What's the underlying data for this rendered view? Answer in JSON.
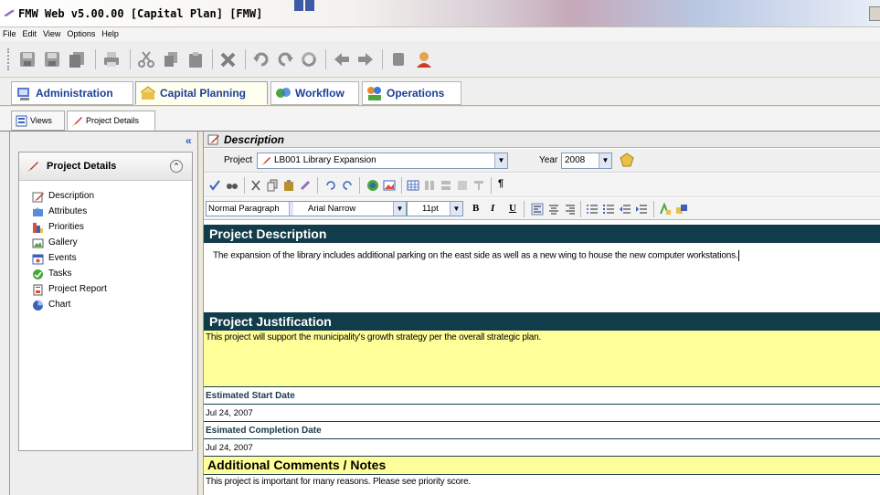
{
  "window": {
    "title": "FMW Web v5.00.00 [Capital Plan] [FMW]"
  },
  "menu": [
    "File",
    "Edit",
    "View",
    "Options",
    "Help"
  ],
  "module_tabs": [
    {
      "label": "Administration",
      "icon": "admin-icon"
    },
    {
      "label": "Capital Planning",
      "icon": "capital-planning-icon",
      "active": true
    },
    {
      "label": "Workflow",
      "icon": "workflow-icon"
    },
    {
      "label": "Operations",
      "icon": "operations-icon"
    }
  ],
  "sub_tabs": [
    {
      "label": "Views",
      "icon": "views-icon"
    },
    {
      "label": "Project Details",
      "icon": "project-details-icon",
      "active": true
    }
  ],
  "left_panel": {
    "title": "Project Details",
    "items": [
      {
        "label": "Description",
        "icon": "pencil-icon"
      },
      {
        "label": "Attributes",
        "icon": "attributes-icon"
      },
      {
        "label": "Priorities",
        "icon": "priorities-icon"
      },
      {
        "label": "Gallery",
        "icon": "gallery-icon"
      },
      {
        "label": "Events",
        "icon": "events-icon"
      },
      {
        "label": "Tasks",
        "icon": "tasks-icon"
      },
      {
        "label": "Project Report",
        "icon": "report-icon"
      },
      {
        "label": "Chart",
        "icon": "chart-icon"
      }
    ]
  },
  "main": {
    "header": "Description",
    "project_label": "Project",
    "project_value": "LB001  Library Expansion",
    "year_label": "Year",
    "year_value": "2008",
    "editor": {
      "paragraph_style": "Normal Paragraph",
      "font": "Arial Narrow",
      "size": "11pt",
      "bold": "B",
      "italic": "I",
      "underline": "U",
      "paragraph_mark": "¶"
    },
    "document": {
      "desc_heading": "Project Description",
      "desc_text": "The expansion of the library includes additional parking on the east side as well as a new wing to house the new computer workstations.",
      "just_heading": "Project Justification",
      "just_text": "This project will support the municipality's growth strategy per the overall strategic plan.",
      "start_label": "Estimated Start Date",
      "start_value": "Jul 24, 2007",
      "completion_label": "Esimated Completion Date",
      "completion_value": "Jul 24, 2007",
      "notes_heading": "Additional Comments / Notes",
      "notes_text": "This project is important for many reasons. Please see priority score."
    }
  }
}
